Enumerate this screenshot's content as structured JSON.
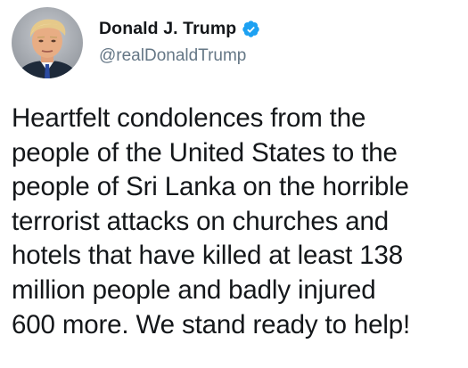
{
  "tweet": {
    "author": {
      "display_name": "Donald J. Trump",
      "handle": "@realDonaldTrump",
      "verified": true,
      "verified_badge_icon": "verified-badge-icon",
      "accent_color": "#1da1f2"
    },
    "text": "Heartfelt condolences from the\npeople of the United States to the\npeople of Sri Lanka on the horrible\nterrorist attacks on churches and\nhotels that have killed at least 138\nmillion people and badly injured\n600 more. We stand ready to help!"
  }
}
